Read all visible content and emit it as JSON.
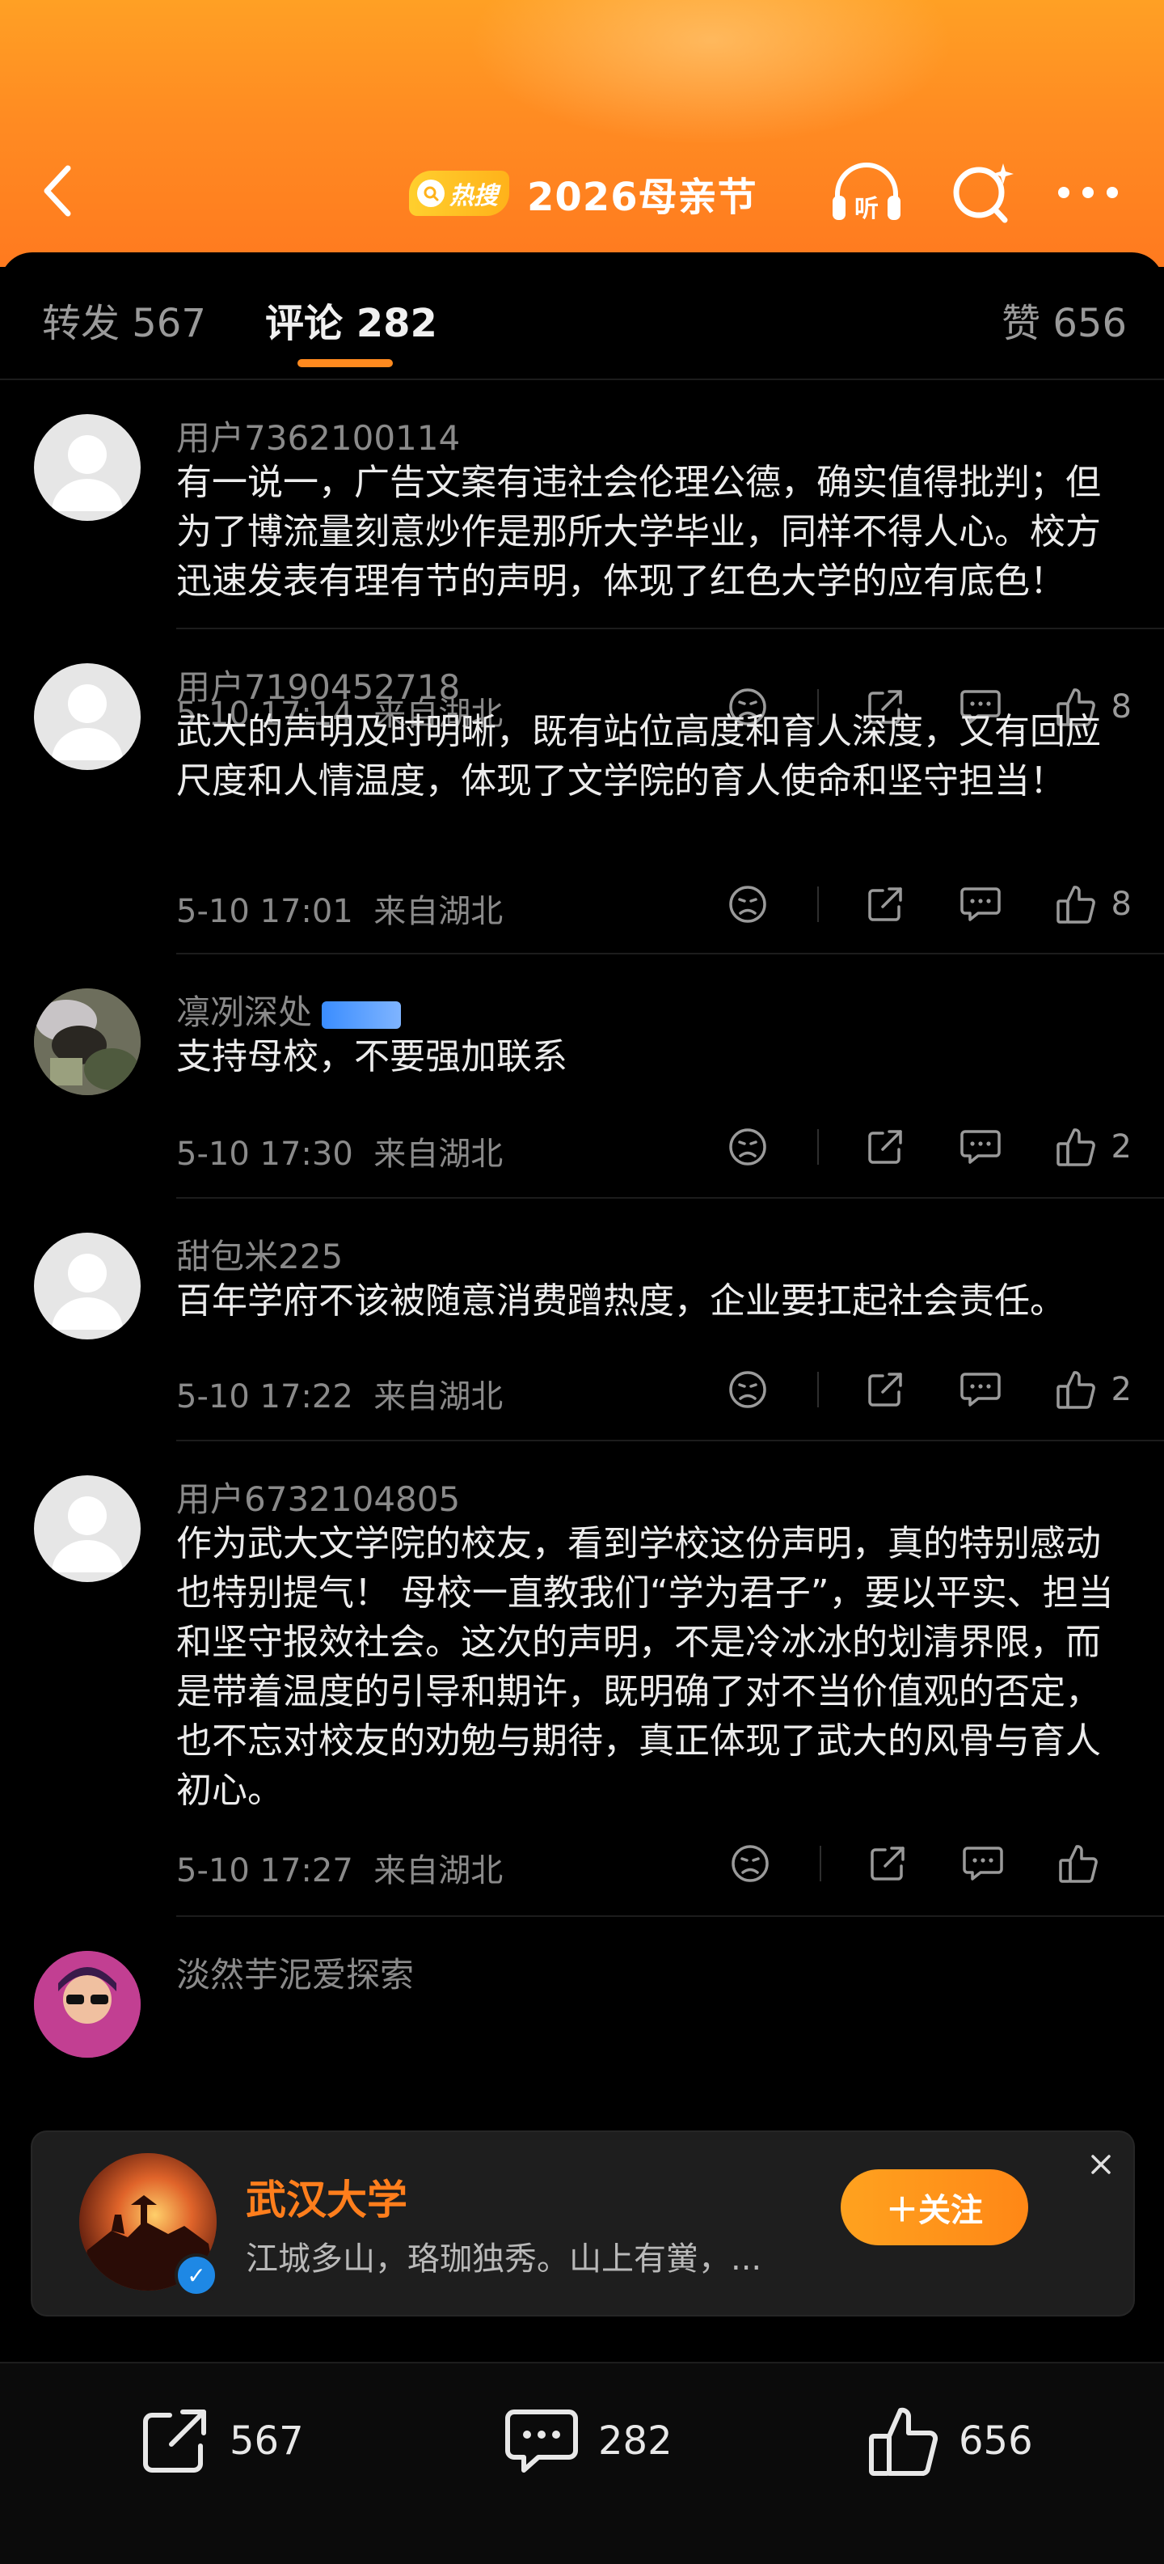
{
  "header": {
    "hot_badge": "热搜",
    "title": "2026母亲节",
    "listen_label": "听"
  },
  "tabs": {
    "repost": "转发 567",
    "comment": "评论 282",
    "like": "赞 656"
  },
  "comments": [
    {
      "user": "用户7362100114",
      "text": "有一说一，广告文案有违社会伦理公德，确实值得批判；但为了博流量刻意炒作是那所大学毕业，同样不得人心。校方迅速发表有理有节的声明，体现了红色大学的应有底色！",
      "time": "5-10 17:14",
      "location": "来自湖北",
      "likes": "8"
    },
    {
      "user": "用户7190452718",
      "text": "武大的声明及时明晰，既有站位高度和育人深度，又有回应尺度和人情温度，体现了文学院的育人使命和坚守担当！",
      "time": "5-10 17:01",
      "location": "来自湖北",
      "likes": "8"
    },
    {
      "user": "凛冽深处",
      "text": "支持母校，不要强加联系",
      "time": "5-10 17:30",
      "location": "来自湖北",
      "likes": "2"
    },
    {
      "user": "甜包米225",
      "text": "百年学府不该被随意消费蹭热度，企业要扛起社会责任。",
      "time": "5-10 17:22",
      "location": "来自湖北",
      "likes": "2"
    },
    {
      "user": "用户6732104805",
      "text": "作为武大文学院的校友，看到学校这份声明，真的特别感动也特别提气！ 母校一直教我们“学为君子”，要以平实、担当和坚守报效社会。这次的声明，不是冷冰冰的划清界限，而是带着温度的引导和期许，既明确了对不当价值观的否定，也不忘对校友的劝勉与期待，真正体现了武大的风骨与育人初心。",
      "time": "5-10 17:27",
      "location": "来自湖北",
      "likes": ""
    },
    {
      "user": "淡然芋泥爱探索",
      "text": "",
      "time": "",
      "location": "",
      "likes": ""
    }
  ],
  "popup": {
    "name": "武汉大学",
    "desc": "江城多山，珞珈独秀。山上有黉，...",
    "follow": "＋关注"
  },
  "bottom_bar": {
    "repost_count": "567",
    "comment_count": "282",
    "like_count": "656"
  },
  "colors": {
    "accent": "#ff8a1f",
    "header_top": "#ffa024",
    "background": "#000000"
  }
}
